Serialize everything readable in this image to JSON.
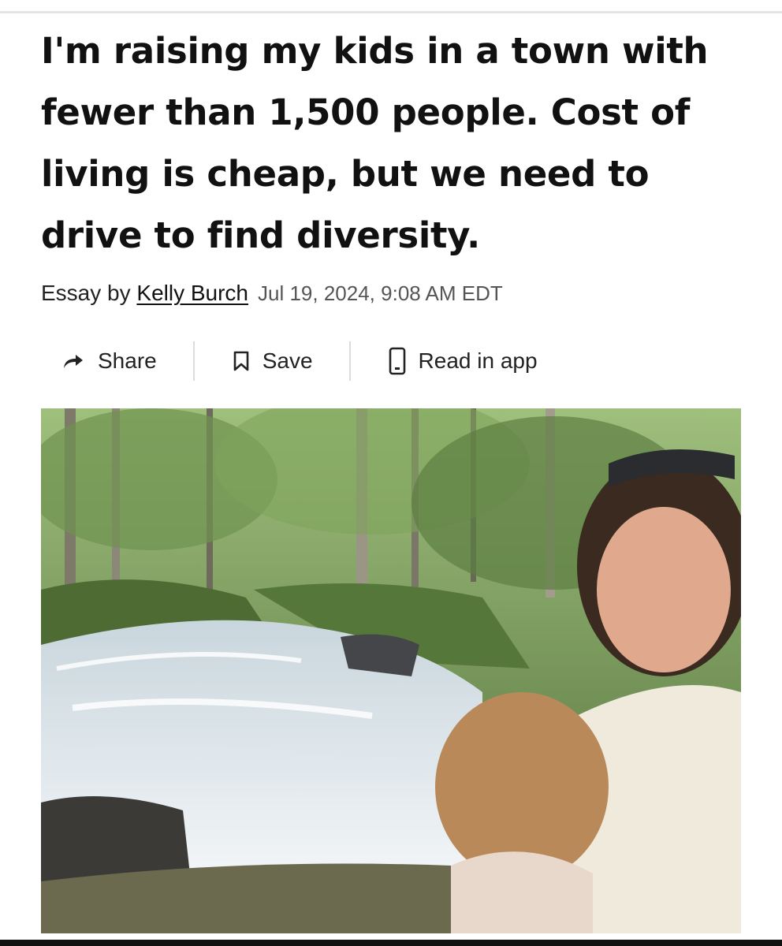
{
  "article": {
    "headline": "I'm raising my kids in a town with fewer than 1,500 people. Cost of living is cheap, but we need to drive to find diversity.",
    "byline_prefix": "Essay by ",
    "author": "Kelly Burch",
    "timestamp": "Jul 19, 2024, 9:08 AM EDT"
  },
  "actions": {
    "share_label": "Share",
    "save_label": "Save",
    "read_in_app_label": "Read in app"
  },
  "icons": {
    "share": "share-arrow-icon",
    "save": "bookmark-icon",
    "app": "phone-icon"
  },
  "hero_image": {
    "description_colors": {
      "forest": "#5f7f45",
      "water": "#e9eef2",
      "rock": "#3b3a37"
    }
  }
}
